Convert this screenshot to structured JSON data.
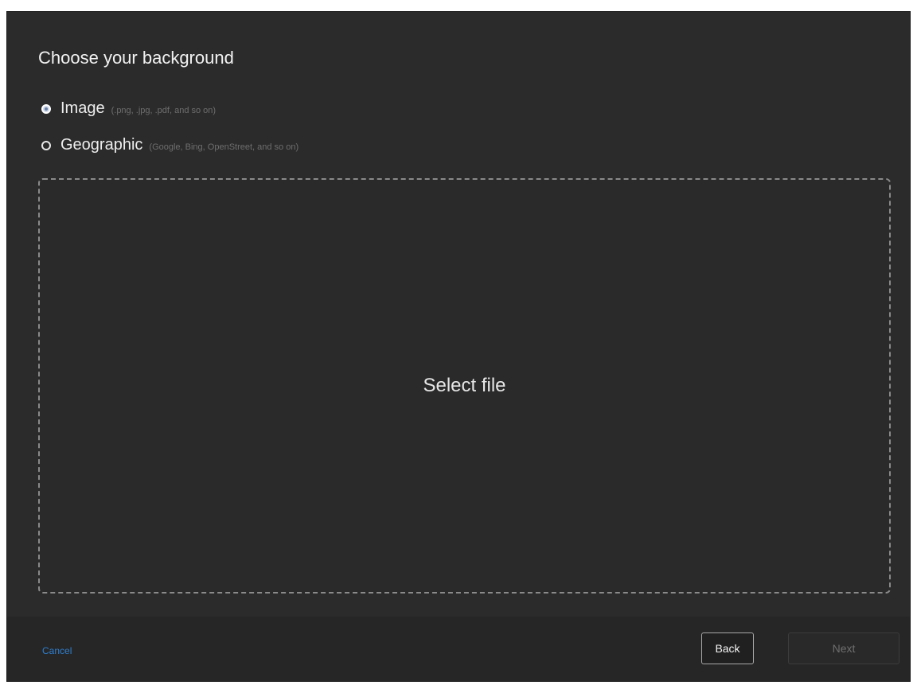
{
  "dialog": {
    "title": "Choose your background"
  },
  "options": [
    {
      "label": "Image",
      "hint": "(.png, .jpg, .pdf, and so on)",
      "selected": true
    },
    {
      "label": "Geographic",
      "hint": "(Google, Bing, OpenStreet, and so on)",
      "selected": false
    }
  ],
  "dropzone": {
    "label": "Select file"
  },
  "footer": {
    "cancel_label": "Cancel",
    "back_label": "Back",
    "next_label": "Next"
  },
  "colors": {
    "background": "#2b2b2b",
    "link": "#2f7fcf",
    "text": "#ededed",
    "hint": "#6e6e6e",
    "disabled_text": "#6f6f6f"
  }
}
